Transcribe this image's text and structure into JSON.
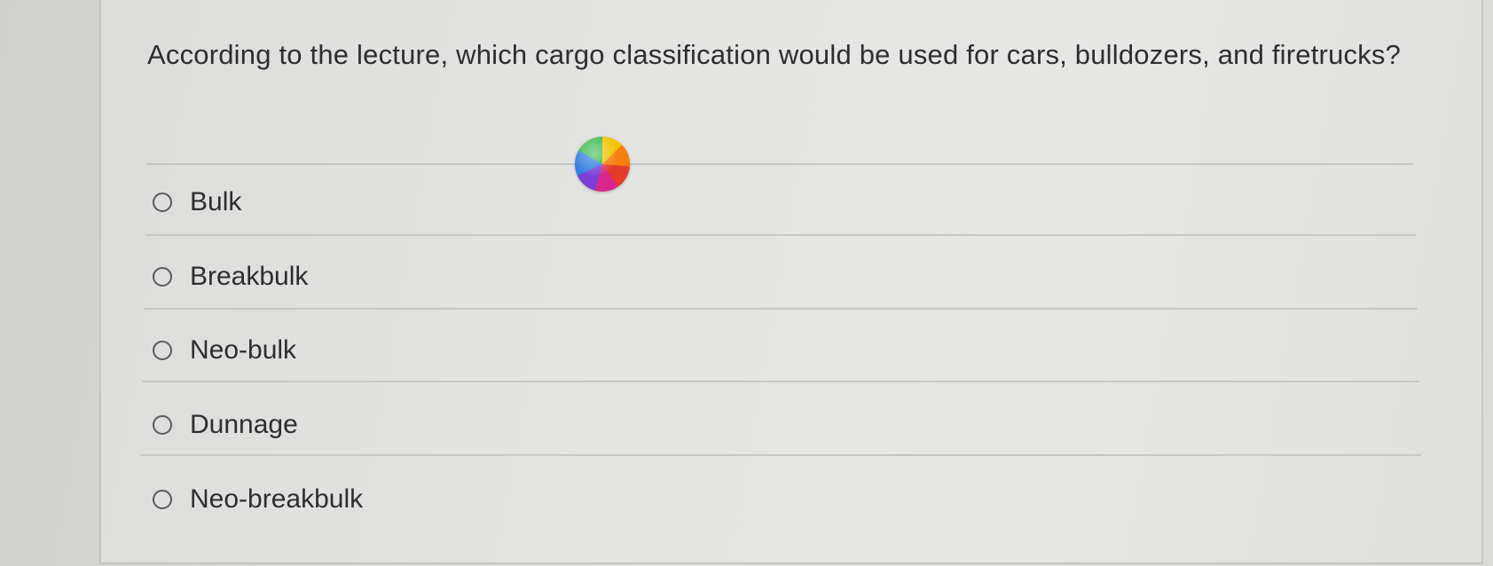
{
  "question": {
    "text": "According to the lecture, which cargo classification would be used for cars, bulldozers, and firetrucks?"
  },
  "options": [
    {
      "label": "Bulk",
      "selected": false
    },
    {
      "label": "Breakbulk",
      "selected": false
    },
    {
      "label": "Neo-bulk",
      "selected": false
    },
    {
      "label": "Dunnage",
      "selected": false
    },
    {
      "label": "Neo-breakbulk",
      "selected": false
    }
  ],
  "loading_indicator": {
    "icon": "spinning-wheel-icon",
    "colors": [
      "#f2c200",
      "#f57e0f",
      "#e63a2a",
      "#d9268a",
      "#7a3fd6",
      "#2f7de1",
      "#35b84a"
    ]
  }
}
